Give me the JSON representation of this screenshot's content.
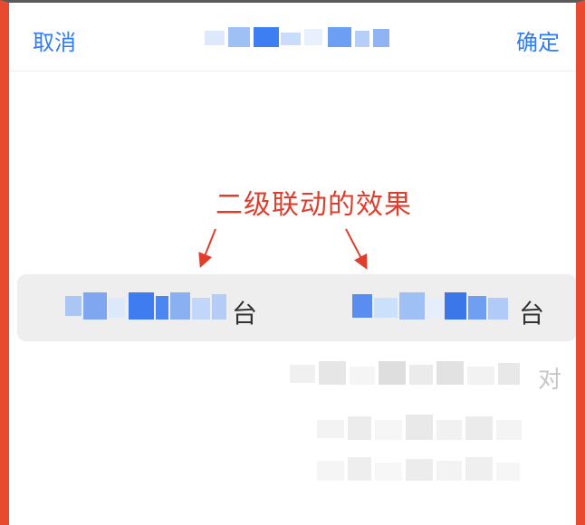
{
  "header": {
    "cancel_label": "取消",
    "confirm_label": "确定"
  },
  "annotation": {
    "text": "二级联动的效果"
  },
  "picker": {
    "selected_left_suffix": "台",
    "selected_right_suffix": "台",
    "next_right_suffix": "对"
  },
  "colors": {
    "accent": "#2F7CF6",
    "annotation": "#E03E2D",
    "frame": "#E84A2F",
    "selection_bg": "#EEEEEF"
  }
}
